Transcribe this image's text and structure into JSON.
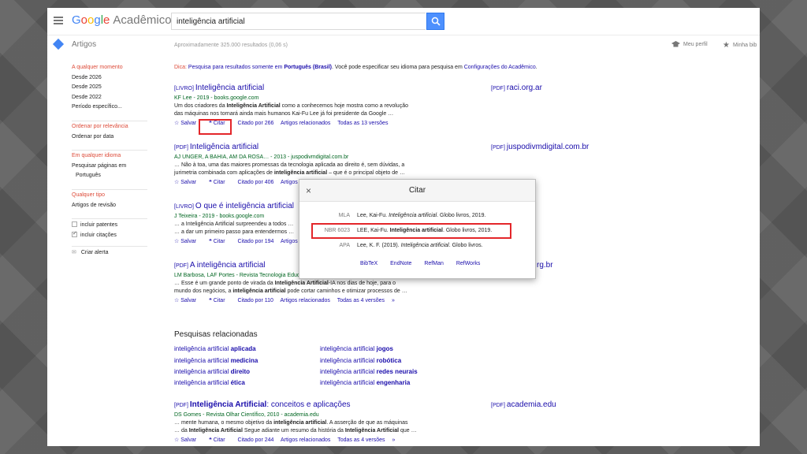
{
  "header": {
    "logo": [
      "G",
      "o",
      "o",
      "g",
      "l",
      "e"
    ],
    "logo_suffix": "Acadêmico",
    "search_value": "inteligência artificial"
  },
  "subbar": {
    "section": "Artigos",
    "result_count": "Aproximadamente 325.000 resultados (0,06 s)",
    "profile": "Meu perfil",
    "library": "Minha bib"
  },
  "sidebar": {
    "time_selected": "A qualquer momento",
    "time_options": [
      "Desde 2026",
      "Desde 2025",
      "Desde 2022",
      "Período específico..."
    ],
    "sort_selected": "Ordenar por relevância",
    "sort_other": "Ordenar por data",
    "lang_selected": "Em qualquer idioma",
    "lang_other_1": "Pesquisar páginas em",
    "lang_other_2": "Português",
    "type_selected": "Qualquer tipo",
    "type_other": "Artigos de revisão",
    "include_patents": "incluir patentes",
    "include_citations": "incluir citações",
    "create_alert": "Criar alerta"
  },
  "tip": {
    "prefix": "Dica:",
    "link1": "Pesquisa para resultados somente em",
    "lang": "Português (Brasil)",
    "middle": ". Você pode especificar seu idioma para pesquisa em",
    "link2": "Configurações do Acadêmico",
    "end": "."
  },
  "results": [
    {
      "tag": "[LIVRO]",
      "title": "Inteligência artificial",
      "authors": "KF Lee - 2019 - books.google.com",
      "snippet1": "Um dos criadores da Inteligência Artificial como a conhecemos hoje mostra como a revolução",
      "snippet2": "das máquinas nos tornará ainda mais humanos Kai-Fu Lee já foi presidente da Google …",
      "save": "Salvar",
      "cite": "Citar",
      "cited_by": "Citado por 266",
      "related": "Artigos relacionados",
      "versions": "Todas as 13 versões",
      "side_tag": "[PDF]",
      "side": "raci.org.ar"
    },
    {
      "tag": "[PDF]",
      "title": "Inteligência artificial",
      "authors": "AJ UNGER, A BAHIA, AM DA ROSA… - 2013 - juspodivmdigital.com.br",
      "snippet1": "… Não à toa, uma das maiores promessas da tecnologia aplicada ao direito é, sem dúvidas, a",
      "snippet2": "jurimetria combinada com aplicações de inteligência artificial – que é o principal objeto de …",
      "save": "Salvar",
      "cite": "Citar",
      "cited_by": "Citado por 406",
      "related": "Artigos relacionados",
      "side_tag": "[PDF]",
      "side": "juspodivmdigital.com.br"
    },
    {
      "tag": "[LIVRO]",
      "title": "O que é inteligência artificial",
      "authors": "J Teixeira - 2019 - books.google.com",
      "snippet1": "… a Inteligência Artificial surpreendeu a todos …",
      "snippet2": "… a dar um primeiro passo para entendermos …",
      "save": "Salvar",
      "cite": "Citar",
      "cited_by": "Citado por 194",
      "related": "Artigos relacionados"
    },
    {
      "tag": "[PDF]",
      "title": "A inteligência artificial",
      "authors": "LM Barbosa, LAF Portes - Revista Tecnologia Educacional",
      "snippet1": "… Esse é um grande ponto de virada da Inteligência Artificial-IA nos dias de hoje, para o",
      "snippet2": "mundo dos negócios, a inteligência artificial pode cortar caminhos e otimizar processos de …",
      "save": "Salvar",
      "cite": "Citar",
      "cited_by": "Citado por 110",
      "related": "Artigos relacionados",
      "versions": "Todas as 4 versões",
      "side": "rg.br"
    },
    {
      "tag": "[PDF]",
      "title": "Inteligência Artificial",
      "title_rest": ": conceitos e aplicações",
      "authors": "DS Gomes - Revista Olhar Científico, 2010 - academia.edu",
      "snippet1": "… mente humana, o mesmo objetivo da inteligência artificial. A asserção de que as máquinas",
      "snippet2": "… da Inteligência Artificial Segue adiante um resumo da história da Inteligência Artificial que …",
      "save": "Salvar",
      "cite": "Citar",
      "cited_by": "Citado por 244",
      "related": "Artigos relacionados",
      "versions": "Todas as 4 versões",
      "side_tag": "[PDF]",
      "side": "academia.edu"
    }
  ],
  "related_searches": {
    "title": "Pesquisas relacionadas",
    "prefix": "inteligência artificial",
    "left": [
      "aplicada",
      "medicina",
      "direito",
      "ética"
    ],
    "right": [
      "jogos",
      "robótica",
      "redes neurais",
      "engenharia"
    ]
  },
  "cite_dialog": {
    "title": "Citar",
    "close": "×",
    "rows": [
      {
        "label": "MLA",
        "pre": "Lee, Kai-Fu. ",
        "em": "Inteligência artificial",
        "post": ". Globo livros, 2019."
      },
      {
        "label": "NBR 6023",
        "pre": "LEE, Kai-Fu. ",
        "strong": "Inteligência artificial",
        "post": ". Globo livros, 2019."
      },
      {
        "label": "APA",
        "pre": "Lee, K. F. (2019). ",
        "em": "Inteligência artificial",
        "post": ". Globo livros."
      }
    ],
    "exports": [
      "BibTeX",
      "EndNote",
      "RefMan",
      "RefWorks"
    ]
  },
  "colors": {
    "link": "#1a0dab",
    "green": "#006621",
    "red_accent": "#dd4b39",
    "highlight": "#e3262a",
    "search_button": "#4d90fe"
  }
}
